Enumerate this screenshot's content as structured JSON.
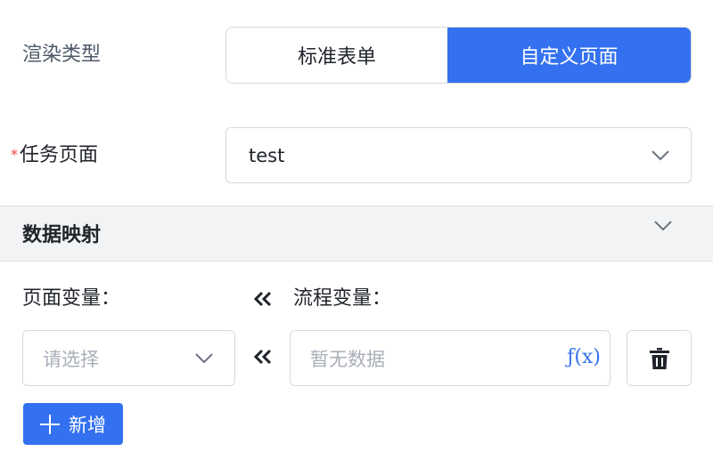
{
  "render_type": {
    "label": "渲染类型",
    "options": [
      "标准表单",
      "自定义页面"
    ],
    "selected": "自定义页面"
  },
  "task_page": {
    "label": "任务页面",
    "required_mark": "*",
    "value": "test",
    "chevron_icon": "chevron-down-icon"
  },
  "data_mapping": {
    "title": "数据映射",
    "collapse_icon": "chevron-down-icon",
    "page_var_label": "页面变量：",
    "flow_var_label": "流程变量：",
    "arrow_icon": "double-chevron-left-icon",
    "row": {
      "page_var_placeholder": "请选择",
      "flow_var_placeholder": "暂无数据",
      "fx_label": "ƒ(x)",
      "delete_icon": "trash-icon"
    },
    "add_button": "新增",
    "add_icon": "plus-icon"
  },
  "colors": {
    "primary": "#3471f0",
    "required": "#f53f3f",
    "section_bg": "#f2f3f5",
    "border": "#d9d9d9"
  }
}
